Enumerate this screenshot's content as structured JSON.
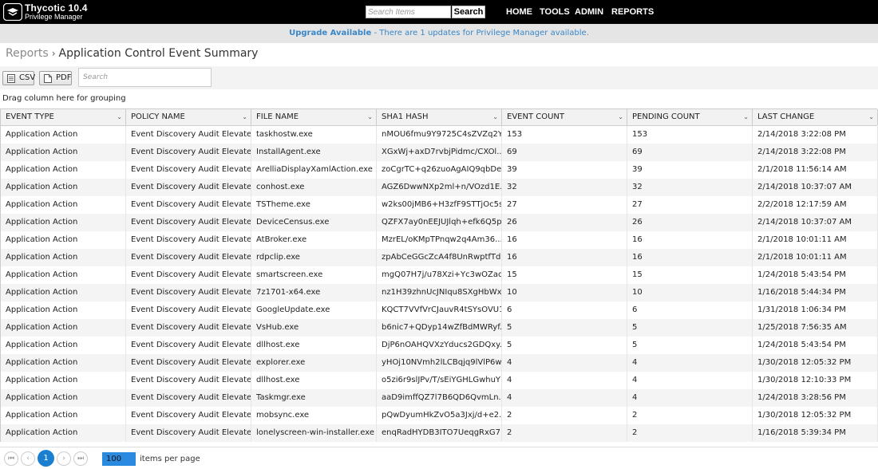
{
  "brand": {
    "title": "Thycotic 10.4",
    "subtitle": "Privilege Manager"
  },
  "top_search": {
    "placeholder": "Search Items",
    "button": "Search"
  },
  "nav": [
    "HOME",
    "TOOLS",
    "ADMIN",
    "REPORTS"
  ],
  "banner": {
    "bold": "Upgrade Available",
    "text": " - There are 1 updates for Privilege Manager available."
  },
  "breadcrumb": {
    "parent": "Reports",
    "separator": "›",
    "title": "Application Control Event Summary"
  },
  "toolbar": {
    "csv": "CSV",
    "pdf": "PDF",
    "search_placeholder": "Search"
  },
  "group_hint": "Drag column here for grouping",
  "columns": [
    "EVENT TYPE",
    "POLICY NAME",
    "FILE NAME",
    "SHA1 HASH",
    "EVENT COUNT",
    "PENDING COUNT",
    "LAST CHANGE"
  ],
  "rows": [
    [
      "Application Action",
      "Event Discovery Audit Elevate...",
      "taskhostw.exe",
      "nMOU6fmu9Y9725C4sZVZq2Y...",
      "153",
      "153",
      "2/14/2018 3:22:08 PM"
    ],
    [
      "Application Action",
      "Event Discovery Audit Elevate...",
      "InstallAgent.exe",
      "XGxWj+axD7rvbjPidmc/CXOl...",
      "69",
      "69",
      "2/14/2018 3:22:08 PM"
    ],
    [
      "Application Action",
      "Event Discovery Audit Elevate...",
      "ArelliaDisplayXamlAction.exe",
      "zoCgrTC+q26zuoAgAIQ9qbDe...",
      "39",
      "39",
      "2/1/2018 11:56:14 AM"
    ],
    [
      "Application Action",
      "Event Discovery Audit Elevate...",
      "conhost.exe",
      "AGZ6DwwNXp2ml+n/VOzd1E...",
      "32",
      "32",
      "2/14/2018 10:37:07 AM"
    ],
    [
      "Application Action",
      "Event Discovery Audit Elevate...",
      "TSTheme.exe",
      "w2ks00jMB6+H3zfF9STTjOc5s...",
      "27",
      "27",
      "2/2/2018 12:17:59 AM"
    ],
    [
      "Application Action",
      "Event Discovery Audit Elevate...",
      "DeviceCensus.exe",
      "QZFX7ay0nEEJUJlqh+efk6Q5p...",
      "26",
      "26",
      "2/14/2018 10:37:07 AM"
    ],
    [
      "Application Action",
      "Event Discovery Audit Elevate...",
      "AtBroker.exe",
      "MzrEL/oKMpTPnqw2q4Am36...",
      "16",
      "16",
      "2/1/2018 10:01:11 AM"
    ],
    [
      "Application Action",
      "Event Discovery Audit Elevate...",
      "rdpclip.exe",
      "zpAbCeGGcZcA4f8UnRwptfTd...",
      "16",
      "16",
      "2/1/2018 10:01:11 AM"
    ],
    [
      "Application Action",
      "Event Discovery Audit Elevate...",
      "smartscreen.exe",
      "mgQ07H7j/u78Xzi+Yc3wOZao...",
      "15",
      "15",
      "1/24/2018 5:43:54 PM"
    ],
    [
      "Application Action",
      "Event Discovery Audit Elevate...",
      "7z1701-x64.exe",
      "nz1H39zhnUcJNIqu8SXgHbWx...",
      "10",
      "10",
      "1/16/2018 5:44:34 PM"
    ],
    [
      "Application Action",
      "Event Discovery Audit Elevate...",
      "GoogleUpdate.exe",
      "KQCT7VVfVrCJauvR4tSYsOVU1...",
      "6",
      "6",
      "1/31/2018 1:06:34 PM"
    ],
    [
      "Application Action",
      "Event Discovery Audit Elevate...",
      "VsHub.exe",
      "b6nic7+QDyp14wZfBdMWRyf...",
      "5",
      "5",
      "1/25/2018 7:56:35 AM"
    ],
    [
      "Application Action",
      "Event Discovery Audit Elevate...",
      "dllhost.exe",
      "DjP6nOAHQVXzYducs2GDQxy...",
      "5",
      "5",
      "1/24/2018 5:43:54 PM"
    ],
    [
      "Application Action",
      "Event Discovery Audit Elevate...",
      "explorer.exe",
      "yHOj10NVmh2lLCBqjq9lVlP6w...",
      "4",
      "4",
      "1/30/2018 12:05:32 PM"
    ],
    [
      "Application Action",
      "Event Discovery Audit Elevate...",
      "dllhost.exe",
      "o5zi6r9slJPv/T/sEiYGHLGwhuY=",
      "4",
      "4",
      "1/30/2018 12:10:33 PM"
    ],
    [
      "Application Action",
      "Event Discovery Audit Elevate...",
      "Taskmgr.exe",
      "aaD9imffQZ7l7B6QD6QvmLn...",
      "4",
      "4",
      "1/24/2018 3:28:56 PM"
    ],
    [
      "Application Action",
      "Event Discovery Audit Elevate...",
      "mobsync.exe",
      "pQwDyumHkZvO5a3Jxj/d+e2...",
      "2",
      "2",
      "1/30/2018 12:05:32 PM"
    ],
    [
      "Application Action",
      "Event Discovery Audit Elevate...",
      "lonelyscreen-win-installer.exe",
      "enqRadHYDB3ITO7UeqgRxG7...",
      "2",
      "2",
      "1/16/2018 5:39:34 PM"
    ]
  ],
  "pager": {
    "current_page": "1",
    "page_size": "100",
    "page_size_label": "items per page",
    "first": "⏮",
    "prev": "‹",
    "next": "›",
    "last": "⏭"
  }
}
